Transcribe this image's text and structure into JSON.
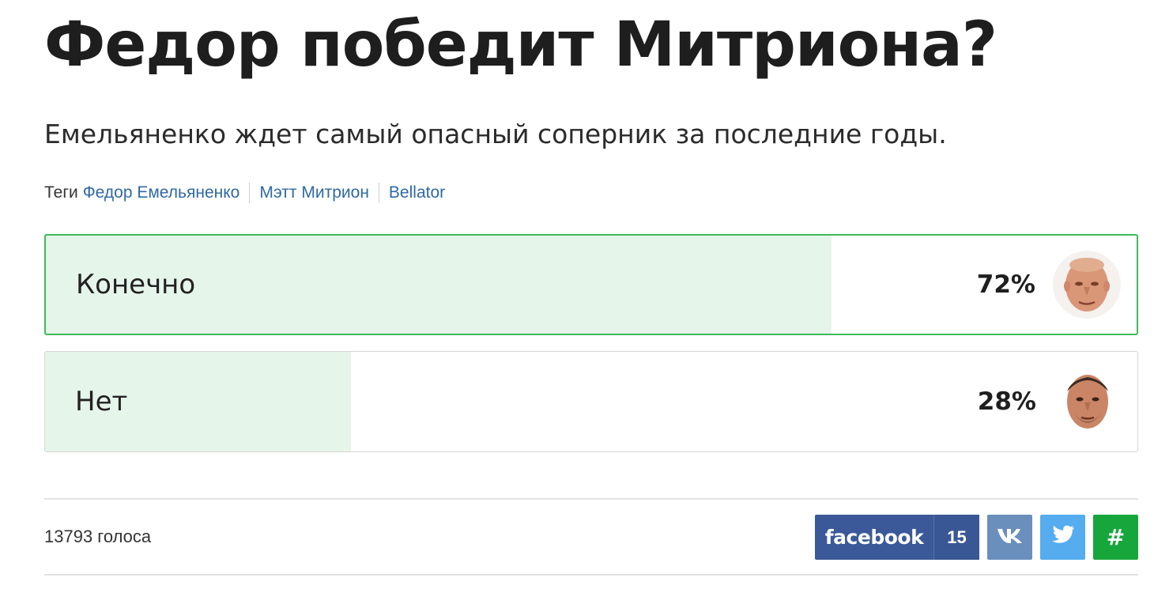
{
  "article": {
    "title": "Федор победит Митриона?",
    "subtitle": "Емельяненко ждет самый опасный соперник за последние годы.",
    "tags_label": "Теги",
    "tags": [
      "Федор Емельяненко",
      "Мэтт Митрион",
      "Bellator"
    ]
  },
  "poll": {
    "options": [
      {
        "label": "Конечно",
        "percent_text": "72%",
        "percent": 72,
        "leading": true,
        "avatar_icon": "fighter-avatar-fedor"
      },
      {
        "label": "Нет",
        "percent_text": "28%",
        "percent": 28,
        "leading": false,
        "avatar_icon": "fighter-avatar-mitrione"
      }
    ],
    "votes_text": "13793 голоса"
  },
  "share": {
    "facebook_label": "facebook",
    "facebook_count": "15",
    "hash_label": "#",
    "icons": [
      "vk-icon",
      "twitter-icon"
    ]
  },
  "colors": {
    "leading_border": "#3fba5a",
    "fill": "#e6f5ea",
    "facebook": "#3b5998",
    "vk": "#6a8fbd",
    "twitter": "#55acee",
    "hash": "#17a63c",
    "tag_link": "#2f69a6"
  }
}
